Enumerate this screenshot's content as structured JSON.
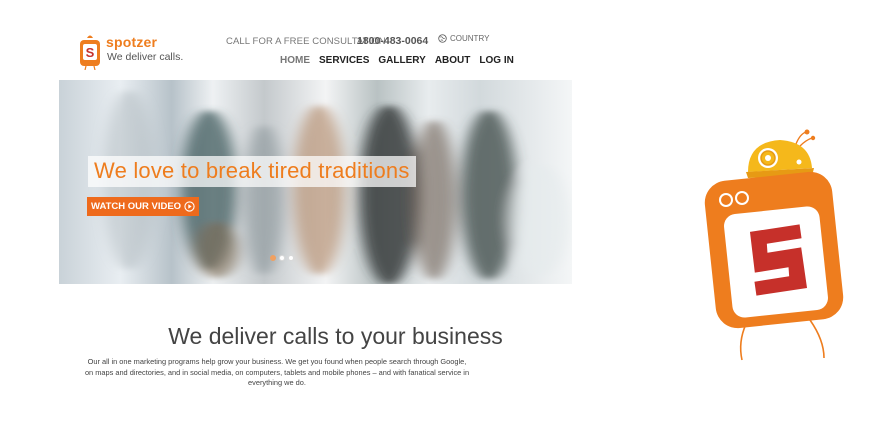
{
  "header": {
    "brand": "spotzer",
    "tagline": "We deliver calls.",
    "consultation_text": "CALL FOR A FREE CONSULTATION",
    "phone": "1800-483-0064",
    "country_label": "COUNTRY"
  },
  "nav": {
    "items": [
      "HOME",
      "SERVICES",
      "GALLERY",
      "ABOUT",
      "LOG IN"
    ]
  },
  "hero": {
    "headline": "We love to break tired traditions",
    "watch_button": "WATCH OUR VIDEO",
    "slides": 3,
    "active_slide": 1
  },
  "section": {
    "title": "We deliver calls to your business",
    "body": "Our all in one marketing programs help grow your business. We get you found when people search through Google, on maps and directories, and in social media, on computers, tablets and mobile phones – and with fanatical service in everything we do."
  },
  "colors": {
    "accent": "#ee7d1e",
    "button": "#ee6a1c",
    "mascot_red": "#c6302a"
  }
}
